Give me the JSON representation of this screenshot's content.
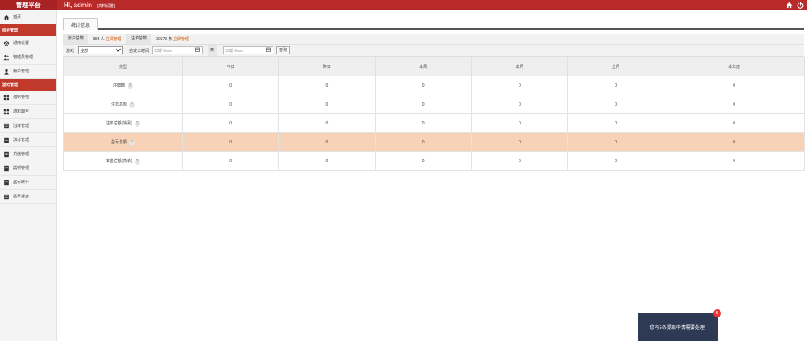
{
  "header": {
    "brand": "管理平台",
    "greeting_prefix": "Hi, ",
    "username": "admin",
    "edit_profile": "[资料设置]",
    "icons": [
      "home-icon",
      "power-icon"
    ]
  },
  "sidebar": {
    "items": [
      {
        "type": "item",
        "label": "首页",
        "icon": "home-icon",
        "name": "home"
      },
      {
        "type": "group",
        "label": "综合管理",
        "name": "general"
      },
      {
        "type": "item",
        "label": "通用设置",
        "icon": "gear-icon",
        "name": "settings"
      },
      {
        "type": "item",
        "label": "管理员管理",
        "icon": "users-icon",
        "name": "admins"
      },
      {
        "type": "item",
        "label": "账户管理",
        "icon": "user-icon",
        "name": "accounts"
      },
      {
        "type": "group",
        "label": "游戏管理",
        "name": "games"
      },
      {
        "type": "item",
        "label": "游戏管理",
        "icon": "grid-icon",
        "name": "game-manage"
      },
      {
        "type": "item",
        "label": "游戏期号",
        "icon": "grid-icon",
        "name": "game-period"
      },
      {
        "type": "item",
        "label": "注单管理",
        "icon": "doc-icon",
        "name": "orders"
      },
      {
        "type": "item",
        "label": "流水管理",
        "icon": "doc-icon",
        "name": "flow"
      },
      {
        "type": "item",
        "label": "充值管理",
        "icon": "doc-icon",
        "name": "recharge"
      },
      {
        "type": "item",
        "label": "提现管理",
        "icon": "doc-icon",
        "name": "withdraw"
      },
      {
        "type": "item",
        "label": "盈亏统计",
        "icon": "doc-icon",
        "name": "profit-stats"
      },
      {
        "type": "item",
        "label": "盈亏报表",
        "icon": "doc-icon",
        "name": "profit-report"
      }
    ]
  },
  "main": {
    "tab": "统计信息",
    "stats": {
      "accounts_label": "账户总数",
      "accounts_value": "895 人",
      "accounts_link": "立即管理",
      "orders_label": "注单总数",
      "orders_value": "30373 条",
      "orders_link": "立即管理"
    },
    "filter": {
      "game_label": "游戏",
      "game_value": "全部",
      "time_label": "自定义时间",
      "date_placeholder_start": "日期 Date",
      "to_label": "到",
      "date_placeholder_end": "日期 Date",
      "search_button": "查询"
    },
    "table": {
      "headers": [
        "类型",
        "今日",
        "昨日",
        "本周",
        "本月",
        "上月",
        "本年度"
      ],
      "rows": [
        {
          "label": "注单数",
          "values": [
            "0",
            "0",
            "0",
            "0",
            "0",
            "0"
          ],
          "highlight": false
        },
        {
          "label": "注单总额",
          "values": [
            "0",
            "0",
            "0",
            "0",
            "0",
            "0"
          ],
          "highlight": false
        },
        {
          "label": "注单总额(输赢)",
          "values": [
            "0",
            "0",
            "0",
            "0",
            "0",
            "0"
          ],
          "highlight": false
        },
        {
          "label": "盈亏总额",
          "values": [
            "0",
            "0",
            "0",
            "0",
            "0",
            "0"
          ],
          "highlight": true
        },
        {
          "label": "本金总额(简单)",
          "values": [
            "0",
            "0",
            "0",
            "0",
            "0",
            "0"
          ],
          "highlight": false
        }
      ],
      "help_glyph": "?"
    }
  },
  "toast": {
    "message": "您有5条提现申请需要处理!",
    "badge": "5"
  },
  "colors": {
    "primary": "#b82a2a",
    "group": "#c0392b",
    "highlight_row": "#f8d2b7",
    "toast_bg": "#2e3a54",
    "link": "#d35400"
  }
}
